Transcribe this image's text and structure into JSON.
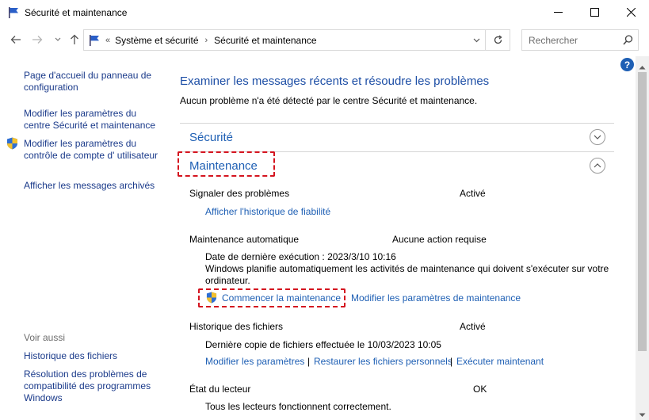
{
  "window": {
    "title": "Sécurité et maintenance"
  },
  "address": {
    "overflow": "«",
    "crumbs": [
      "Système et sécurité",
      "Sécurité et maintenance"
    ],
    "search_placeholder": "Rechercher"
  },
  "help_label": "?",
  "sidebar": {
    "links": [
      "Page d'accueil du panneau de configuration",
      "Modifier les paramètres du centre Sécurité et maintenance",
      "Modifier les paramètres du contrôle de compte d' utilisateur",
      "Afficher les messages archivés"
    ],
    "see_also_label": "Voir aussi",
    "see_also": [
      "Historique des fichiers",
      "Résolution des problèmes de compatibilité des programmes Windows"
    ]
  },
  "main": {
    "heading": "Examiner les messages récents et résoudre les problèmes",
    "subheading": "Aucun problème n'a été détecté par le centre Sécurité et maintenance.",
    "security_title": "Sécurité",
    "maintenance_title": "Maintenance",
    "report": {
      "label": "Signaler des problèmes",
      "status": "Activé",
      "link": "Afficher l'historique de fiabilité"
    },
    "auto": {
      "label": "Maintenance automatique",
      "status": "Aucune action requise",
      "last_run": "Date de dernière exécution : 2023/3/10 10:16",
      "desc_line1": "Windows planifie automatiquement les activités de maintenance qui doivent s'exécuter sur votre",
      "desc_line2": "ordinateur.",
      "start_link": "Commencer la maintenance",
      "settings_link": "Modifier les paramètres de maintenance"
    },
    "history": {
      "label": "Historique des fichiers",
      "status": "Activé",
      "last_copy": "Dernière copie de fichiers effectuée le 10/03/2023 10:05",
      "links": [
        "Modifier les paramètres",
        "Restaurer les fichiers personnels",
        "Exécuter maintenant"
      ]
    },
    "drive": {
      "label": "État du lecteur",
      "status": "OK",
      "detail": "Tous les lecteurs fonctionnent correctement."
    }
  },
  "colors": {
    "link": "#1e5fb4",
    "highlight_dash": "#d4141f"
  }
}
